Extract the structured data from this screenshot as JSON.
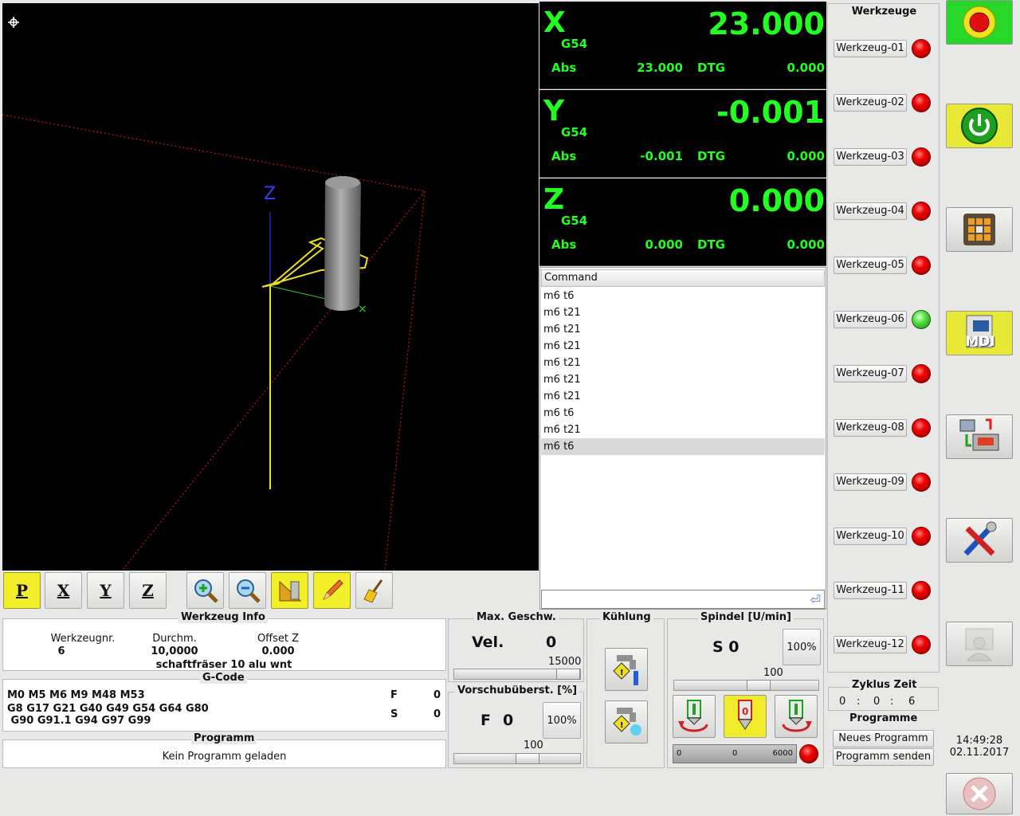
{
  "preview": {
    "axis_label_z": "Z"
  },
  "view_toolbar": {
    "buttons": [
      {
        "label": "P",
        "active": true
      },
      {
        "label": "X",
        "active": false
      },
      {
        "label": "Y",
        "active": false
      },
      {
        "label": "Z",
        "active": false
      }
    ]
  },
  "dro": {
    "x": {
      "axis": "X",
      "coord": "G54",
      "value": "23.000",
      "abs_label": "Abs",
      "abs": "23.000",
      "dtg_label": "DTG",
      "dtg": "0.000"
    },
    "y": {
      "axis": "Y",
      "coord": "G54",
      "value": "-0.001",
      "abs_label": "Abs",
      "abs": "-0.001",
      "dtg_label": "DTG",
      "dtg": "0.000"
    },
    "z": {
      "axis": "Z",
      "coord": "G54",
      "value": "0.000",
      "abs_label": "Abs",
      "abs": "0.000",
      "dtg_label": "DTG",
      "dtg": "0.000"
    }
  },
  "command": {
    "header": "Command",
    "history": [
      "m6 t6",
      "m6 t21",
      "m6 t21",
      "m6 t21",
      "m6 t21",
      "m6 t21",
      "m6 t21",
      "m6 t6",
      "m6 t21",
      "m6 t6"
    ],
    "selected_index": 9,
    "input_value": ""
  },
  "tools": {
    "title": "Werkzeuge",
    "items": [
      {
        "label": "Werkzeug-01",
        "status": "red"
      },
      {
        "label": "Werkzeug-02",
        "status": "red"
      },
      {
        "label": "Werkzeug-03",
        "status": "red"
      },
      {
        "label": "Werkzeug-04",
        "status": "red"
      },
      {
        "label": "Werkzeug-05",
        "status": "red"
      },
      {
        "label": "Werkzeug-06",
        "status": "green"
      },
      {
        "label": "Werkzeug-07",
        "status": "red"
      },
      {
        "label": "Werkzeug-08",
        "status": "red"
      },
      {
        "label": "Werkzeug-09",
        "status": "red"
      },
      {
        "label": "Werkzeug-10",
        "status": "red"
      },
      {
        "label": "Werkzeug-11",
        "status": "red"
      },
      {
        "label": "Werkzeug-12",
        "status": "red"
      }
    ]
  },
  "right_buttons": {
    "mdi_label": "MDI"
  },
  "tool_info": {
    "title": "Werkzeug Info",
    "nr_label": "Werkzeugnr.",
    "nr": "6",
    "diam_label": "Durchm.",
    "diam": "10,0000",
    "offset_label": "Offset Z",
    "offset": "0.000",
    "desc": "schaftfräser 10 alu wnt"
  },
  "gcode": {
    "title": "G-Code",
    "line1": "M0 M5 M6 M9 M48 M53",
    "line2": "G8 G17 G21 G40 G49 G54 G64 G80",
    "line3": " G90 G91.1 G94 G97 G99",
    "f_label": "F",
    "f_value": "0",
    "s_label": "S",
    "s_value": "0"
  },
  "program": {
    "title": "Programm",
    "status": "Kein Programm geladen"
  },
  "max_speed": {
    "title": "Max. Geschw.",
    "label": "Vel.",
    "value": "0",
    "slider_max": "15000",
    "slider_fraction": 1.0
  },
  "feed_override": {
    "title": "Vorschubüberst. [%]",
    "label": "F",
    "value": "0",
    "button": "100%",
    "slider_value": "100",
    "slider_fraction": 0.6
  },
  "coolant": {
    "title": "Kühlung"
  },
  "spindle": {
    "title": "Spindel [U/min]",
    "value": "S 0",
    "button": "100%",
    "slider_value": "100",
    "slider_fraction": 0.6,
    "bar_min": "0",
    "bar_value": "0",
    "bar_max": "6000"
  },
  "cycle": {
    "title": "Zyklus Zeit",
    "h": "0",
    "sep1": ":",
    "m": "0",
    "sep2": ":",
    "s": "6"
  },
  "programs": {
    "title": "Programme",
    "new_label": "Neues Programm",
    "send_label": "Programm senden"
  },
  "clock": {
    "time": "14:49:28",
    "date": "02.11.2017"
  }
}
